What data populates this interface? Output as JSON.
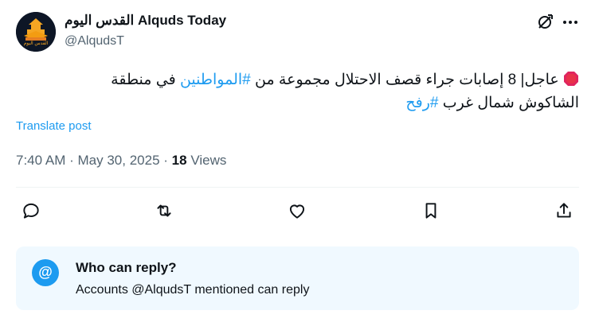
{
  "author": {
    "display_name": "القدس اليوم Alquds Today",
    "handle": "@AlqudsT",
    "avatar_text": "القدس اليوم"
  },
  "post": {
    "line1_part1": "عاجل| 8 إصابات جراء قصف الاحتلال مجموعة من ",
    "hashtag1": "#المواطنين",
    "line1_part2": " في منطقة",
    "line2_part1": "الشاكوش شمال غرب ",
    "hashtag2": "#رفح",
    "stop_icon": "stop-sign-icon"
  },
  "translate_label": "Translate post",
  "meta": {
    "time": "7:40 AM",
    "date": "May 30, 2025",
    "views_count": "18",
    "views_label": "Views"
  },
  "reply_restriction": {
    "title": "Who can reply?",
    "subtitle": "Accounts @AlqudsT mentioned can reply",
    "icon_text": "@"
  },
  "colors": {
    "accent": "#1d9bf0",
    "secondary_text": "#536471",
    "reply_box_bg": "#f0f9ff"
  }
}
